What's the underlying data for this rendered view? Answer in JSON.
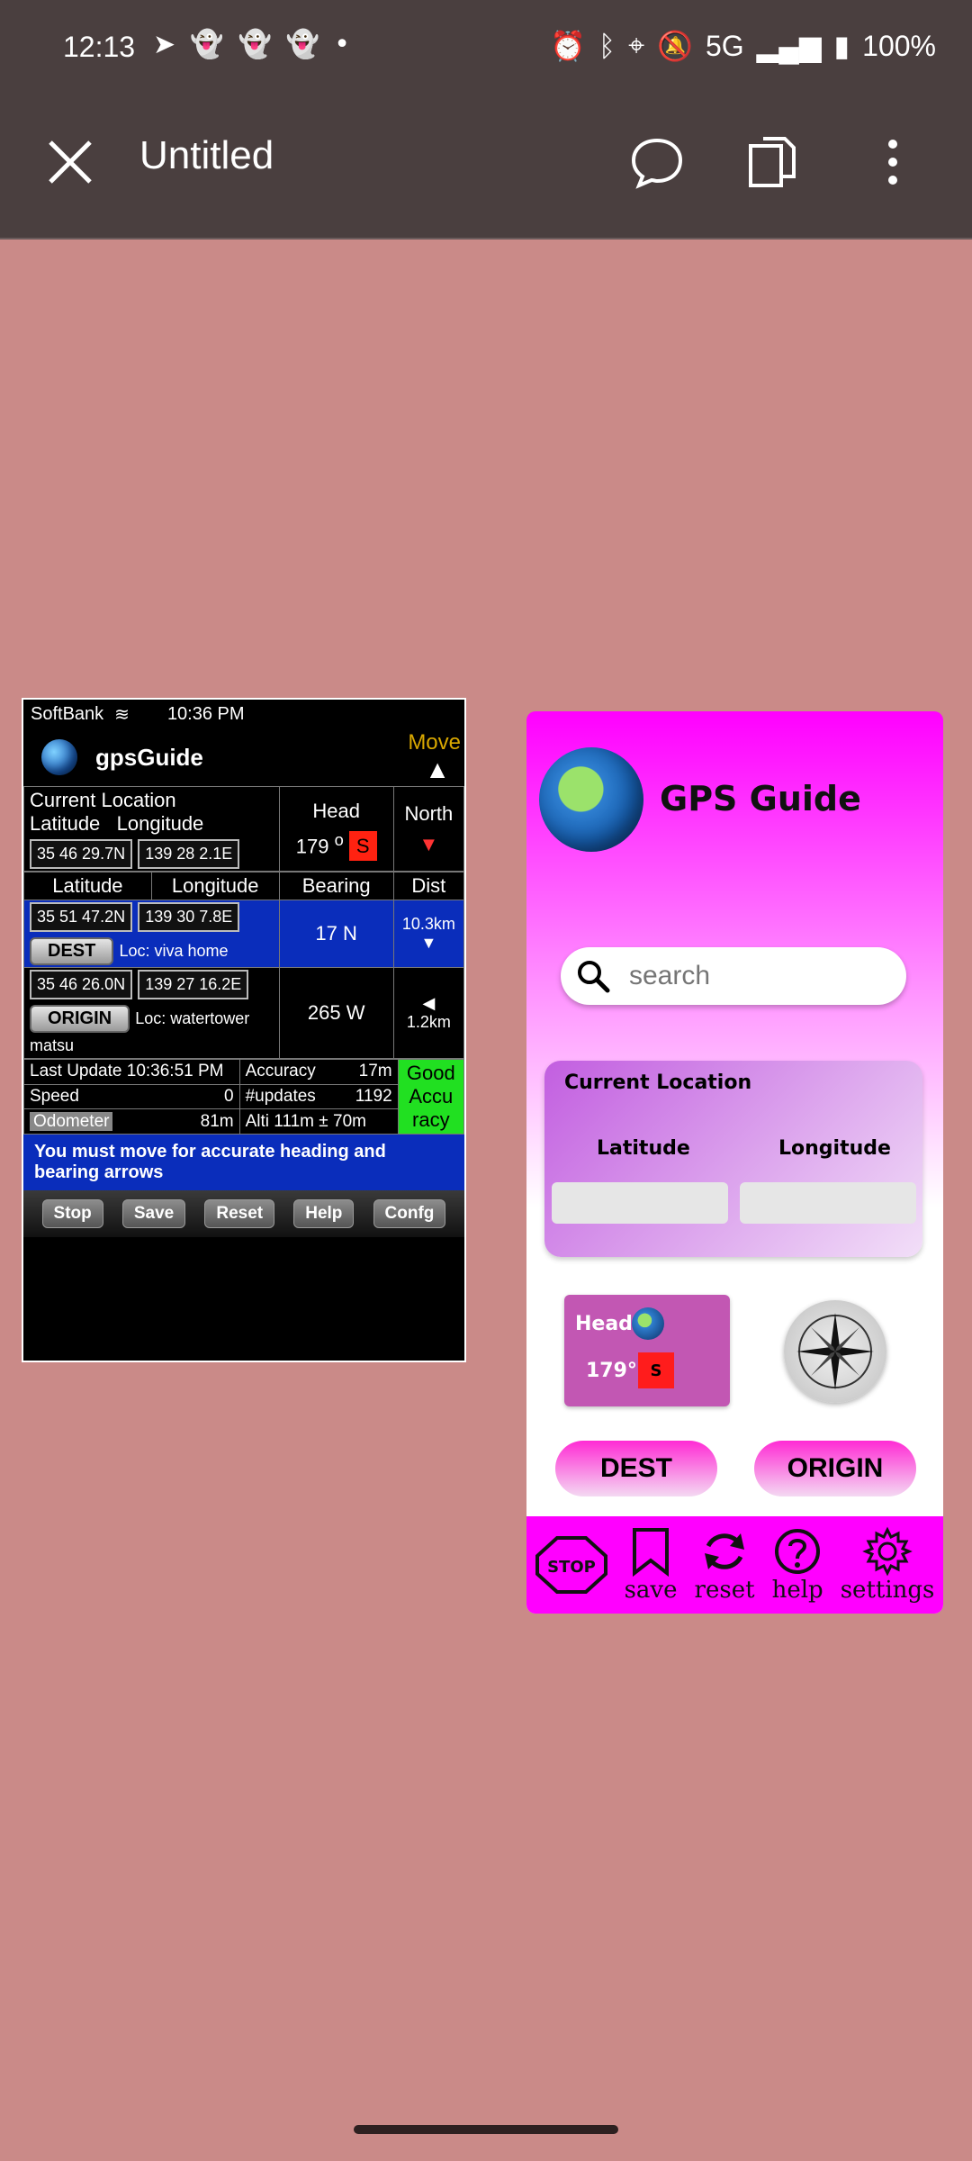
{
  "status_bar": {
    "time": "12:13",
    "network": "5G",
    "battery": "100%"
  },
  "app_bar": {
    "title": "Untitled"
  },
  "legacy_app": {
    "carrier": "SoftBank",
    "time": "10:36 PM",
    "title": "gpsGuide",
    "move_label": "Move",
    "current_location": "Current Location",
    "latitude": "Latitude",
    "longitude": "Longitude",
    "head": "Head",
    "north": "North",
    "cur_lat": "35 46 29.7N",
    "cur_lon": "139 28 2.1E",
    "head_val": "179",
    "degree": "o",
    "head_dir": "S",
    "bearing": "Bearing",
    "dist": "Dist",
    "dest_lat": "35 51 47.2N",
    "dest_lon": "139 30 7.8E",
    "dest_bearing": "17",
    "dest_dir": "N",
    "dest_dist": "10.3km",
    "dest_btn": "DEST",
    "dest_loc": "Loc:  viva home",
    "orig_lat": "35 46 26.0N",
    "orig_lon": "139 27 16.2E",
    "orig_bearing": "265",
    "orig_dir": "W",
    "orig_dist": "1.2km",
    "origin_btn": "ORIGIN",
    "orig_loc": "Loc:  watertower matsu",
    "last_update_label": "Last Update",
    "last_update": "10:36:51 PM",
    "accuracy_label": "Accuracy",
    "accuracy": "17m",
    "speed_label": "Speed",
    "speed": "0",
    "updates_label": "#updates",
    "updates": "1192",
    "odometer_label": "Odometer",
    "odometer": "81m",
    "alti_label": "Alti",
    "alti": "111m",
    "alti_pm": "± 70m",
    "good_accuracy": "Good Accu racy",
    "notice": "You must move for accurate heading and bearing arrows",
    "toolbar": [
      "Stop",
      "Save",
      "Reset",
      "Help",
      "Confg"
    ]
  },
  "mockup": {
    "title": "GPS Guide",
    "search_placeholder": "search",
    "current_location": "Current Location",
    "latitude": "Latitude",
    "longitude": "Longitude",
    "head": "Head",
    "head_value": "179°",
    "head_dir": "S",
    "dest": "DEST",
    "origin": "ORIGIN",
    "nav": {
      "stop_icon_text": "STOP",
      "save": "save",
      "reset": "reset",
      "help": "help",
      "settings": "settings"
    }
  }
}
